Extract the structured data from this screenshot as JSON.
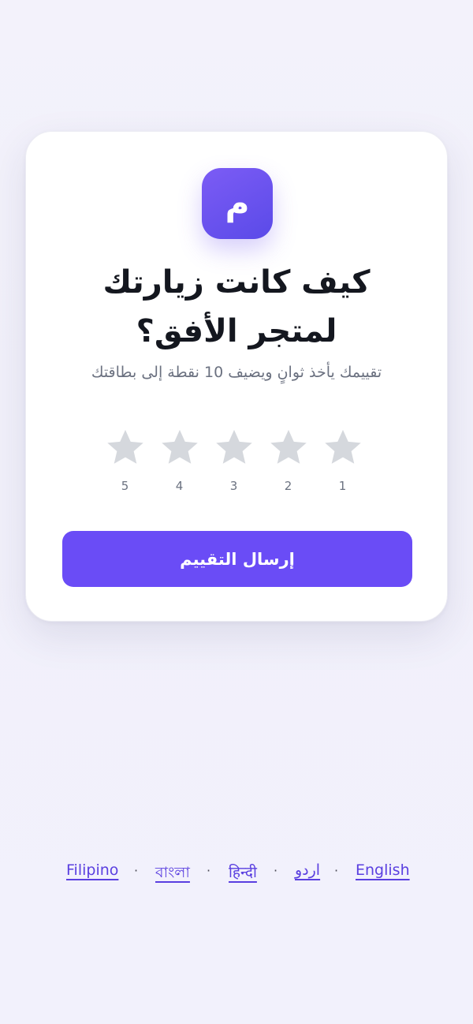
{
  "logo": {
    "letter": "م"
  },
  "title": "كيف كانت زيارتك لمتجر الأفق؟",
  "subtitle": "تقييمك يأخذ ثوانٍ ويضيف 10 نقطة إلى بطاقتك",
  "rating": {
    "star_color": "#d5d8dd",
    "labels": [
      "5",
      "4",
      "3",
      "2",
      "1"
    ]
  },
  "submit_label": "إرسال التقييم",
  "languages": [
    "Filipino",
    "বাংলা",
    "हिन्दी",
    "اردو",
    "English"
  ],
  "separator": "·",
  "colors": {
    "accent": "#6a4cf6",
    "link": "#5a3fe0",
    "title": "#14171f"
  }
}
